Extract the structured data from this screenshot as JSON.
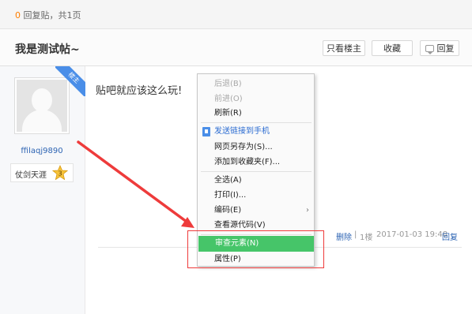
{
  "stats": {
    "prefix": "0",
    "rest": " 回复贴，共1页"
  },
  "thread": {
    "title": "我是测试帖~"
  },
  "actions": {
    "only_op": "只看楼主",
    "favorite": "收藏",
    "reply": "回复"
  },
  "author": {
    "op_tag": "楼主",
    "username": "ffilaqj9890",
    "level_name": "仗剑天涯",
    "level": "3"
  },
  "post": {
    "content": "贴吧就应该这么玩!",
    "footer": {
      "delete": "删除",
      "separator": "|",
      "floor": "1楼",
      "time": "2017-01-03 19:48",
      "reply": "回复"
    }
  },
  "context_menu": {
    "items": [
      {
        "label": "后退(B)",
        "state": "disabled"
      },
      {
        "label": "前进(O)",
        "state": "disabled"
      },
      {
        "label": "刷新(R)",
        "state": "normal"
      },
      {
        "label": "发送链接到手机",
        "state": "normal"
      },
      {
        "label": "网页另存为(S)...",
        "state": "normal"
      },
      {
        "label": "添加到收藏夹(F)...",
        "state": "normal"
      },
      {
        "label": "全选(A)",
        "state": "normal"
      },
      {
        "label": "打印(I)...",
        "state": "normal"
      },
      {
        "label": "编码(E)",
        "state": "normal"
      },
      {
        "label": "查看源代码(V)",
        "state": "normal"
      },
      {
        "label": "审查元素(N)",
        "state": "highlighted"
      },
      {
        "label": "属性(P)",
        "state": "normal"
      }
    ]
  },
  "colors": {
    "accent_blue": "#2d64b3",
    "highlight_green": "#46c569",
    "annotation_red": "#ee3b3b",
    "reply_count_orange": "#ff7f00"
  }
}
